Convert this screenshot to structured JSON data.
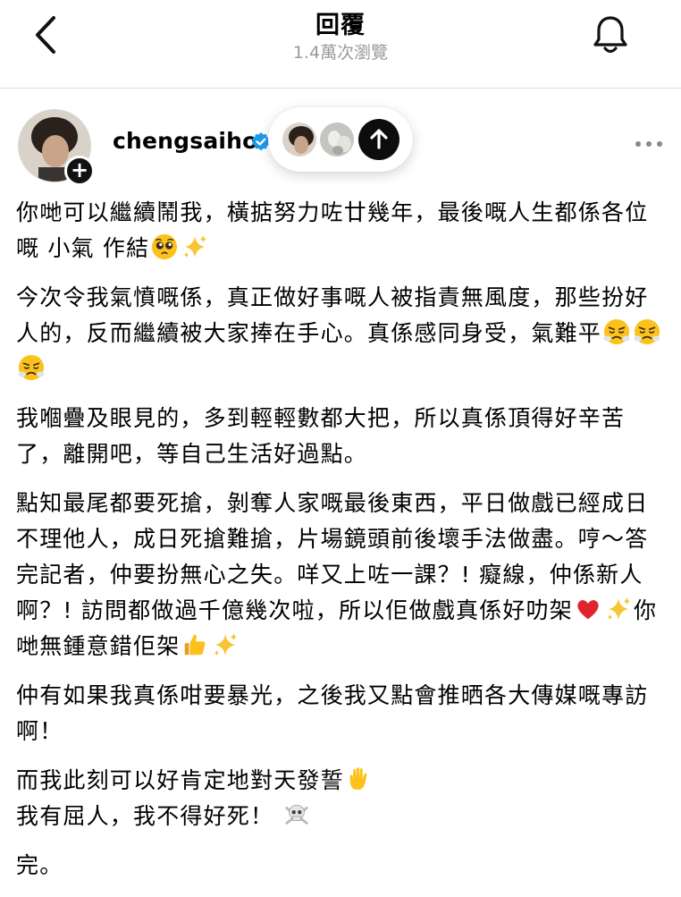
{
  "header": {
    "title": "回覆",
    "views": "1.4萬次瀏覽",
    "back_icon": "chevron-left-icon",
    "notify_icon": "bell-icon"
  },
  "post": {
    "username": "chengsaiho",
    "verified_icon": "verified-badge-icon",
    "accent_color": "#1d9bf0",
    "more_icon": "more-horizontal-icon",
    "pill_icon": "arrow-up-icon",
    "paragraphs": [
      [
        {
          "t": "你哋可以繼續鬧我，橫掂努力咗廿幾年，最後嘅人生都係各位嘅 小氣 作結"
        },
        {
          "e": "pleading-face-emoji"
        },
        {
          "e": "sparkles-emoji"
        }
      ],
      [
        {
          "t": "今次令我氣憤嘅係，真正做好事嘅人被指責無風度，那些扮好人的，反而繼續被大家捧在手心。真係感同身受，氣難平"
        },
        {
          "e": "steam-nose-emoji"
        },
        {
          "e": "steam-nose-emoji"
        },
        {
          "e": "steam-nose-emoji"
        }
      ],
      [
        {
          "t": "我嗰疊及眼見的，多到輕輕數都大把，所以真係頂得好辛苦了，離開吧，等自己生活好過點。"
        }
      ],
      [
        {
          "t": "點知最尾都要死搶，剝奪人家嘅最後東西，平日做戲已經成日不理他人，成日死搶難搶，片場鏡頭前後壞手法做盡。哼～答完記者，仲要扮無心之失。咩又上咗一課？! 癡線，仲係新人啊？! 訪問都做過千億幾次啦，所以佢做戲真係好叻架"
        },
        {
          "e": "red-heart-emoji"
        },
        {
          "e": "sparkles-emoji"
        },
        {
          "t": "你哋無鍾意錯佢架"
        },
        {
          "e": "thumbs-up-emoji"
        },
        {
          "e": "sparkles-emoji"
        }
      ],
      [
        {
          "t": "仲有如果我真係咁要暴光，之後我又點會推晒各大傳媒嘅專訪啊！"
        }
      ],
      [
        {
          "t": "而我此刻可以好肯定地對天發誓"
        },
        {
          "e": "raised-hand-emoji"
        },
        {
          "br": true
        },
        {
          "t": "我有屈人，我不得好死！ "
        },
        {
          "e": "skull-crossbones-emoji"
        }
      ],
      [
        {
          "t": "完。"
        }
      ]
    ]
  }
}
